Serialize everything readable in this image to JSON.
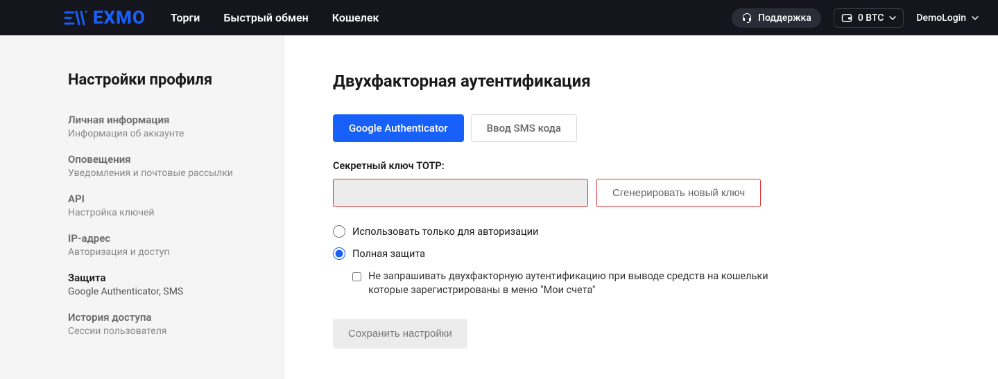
{
  "header": {
    "brand": "EXMO",
    "nav": [
      "Торги",
      "Быстрый обмен",
      "Кошелек"
    ],
    "support": "Поддержка",
    "balance": "0 BTC",
    "user": "DemoLogin"
  },
  "sidebar": {
    "title": "Настройки профиля",
    "items": [
      {
        "title": "Личная информация",
        "sub": "Информация об аккаунте"
      },
      {
        "title": "Оповещения",
        "sub": "Уведомления и почтовые рассылки"
      },
      {
        "title": "API",
        "sub": "Настройка ключей"
      },
      {
        "title": "IP-адрес",
        "sub": "Авторизация и доступ"
      },
      {
        "title": "Защита",
        "sub": "Google Authenticator, SMS"
      },
      {
        "title": "История доступа",
        "sub": "Сессии пользователя"
      }
    ]
  },
  "main": {
    "heading": "Двухфакторная аутентификация",
    "tabs": {
      "google": "Google Authenticator",
      "sms": "Ввод SMS кода"
    },
    "secret_label": "Секретный ключ TOTP:",
    "secret_value": "",
    "generate_btn": "Сгенерировать новый ключ",
    "radio_auth_only": "Использовать только для авторизации",
    "radio_full": "Полная защита",
    "checkbox_wallets": "Не запрашивать двухфакторную аутентификацию при выводе средств на кошельки которые зарегистрированы в меню \"Мои счета\"",
    "save_btn": "Сохранить настройки"
  }
}
